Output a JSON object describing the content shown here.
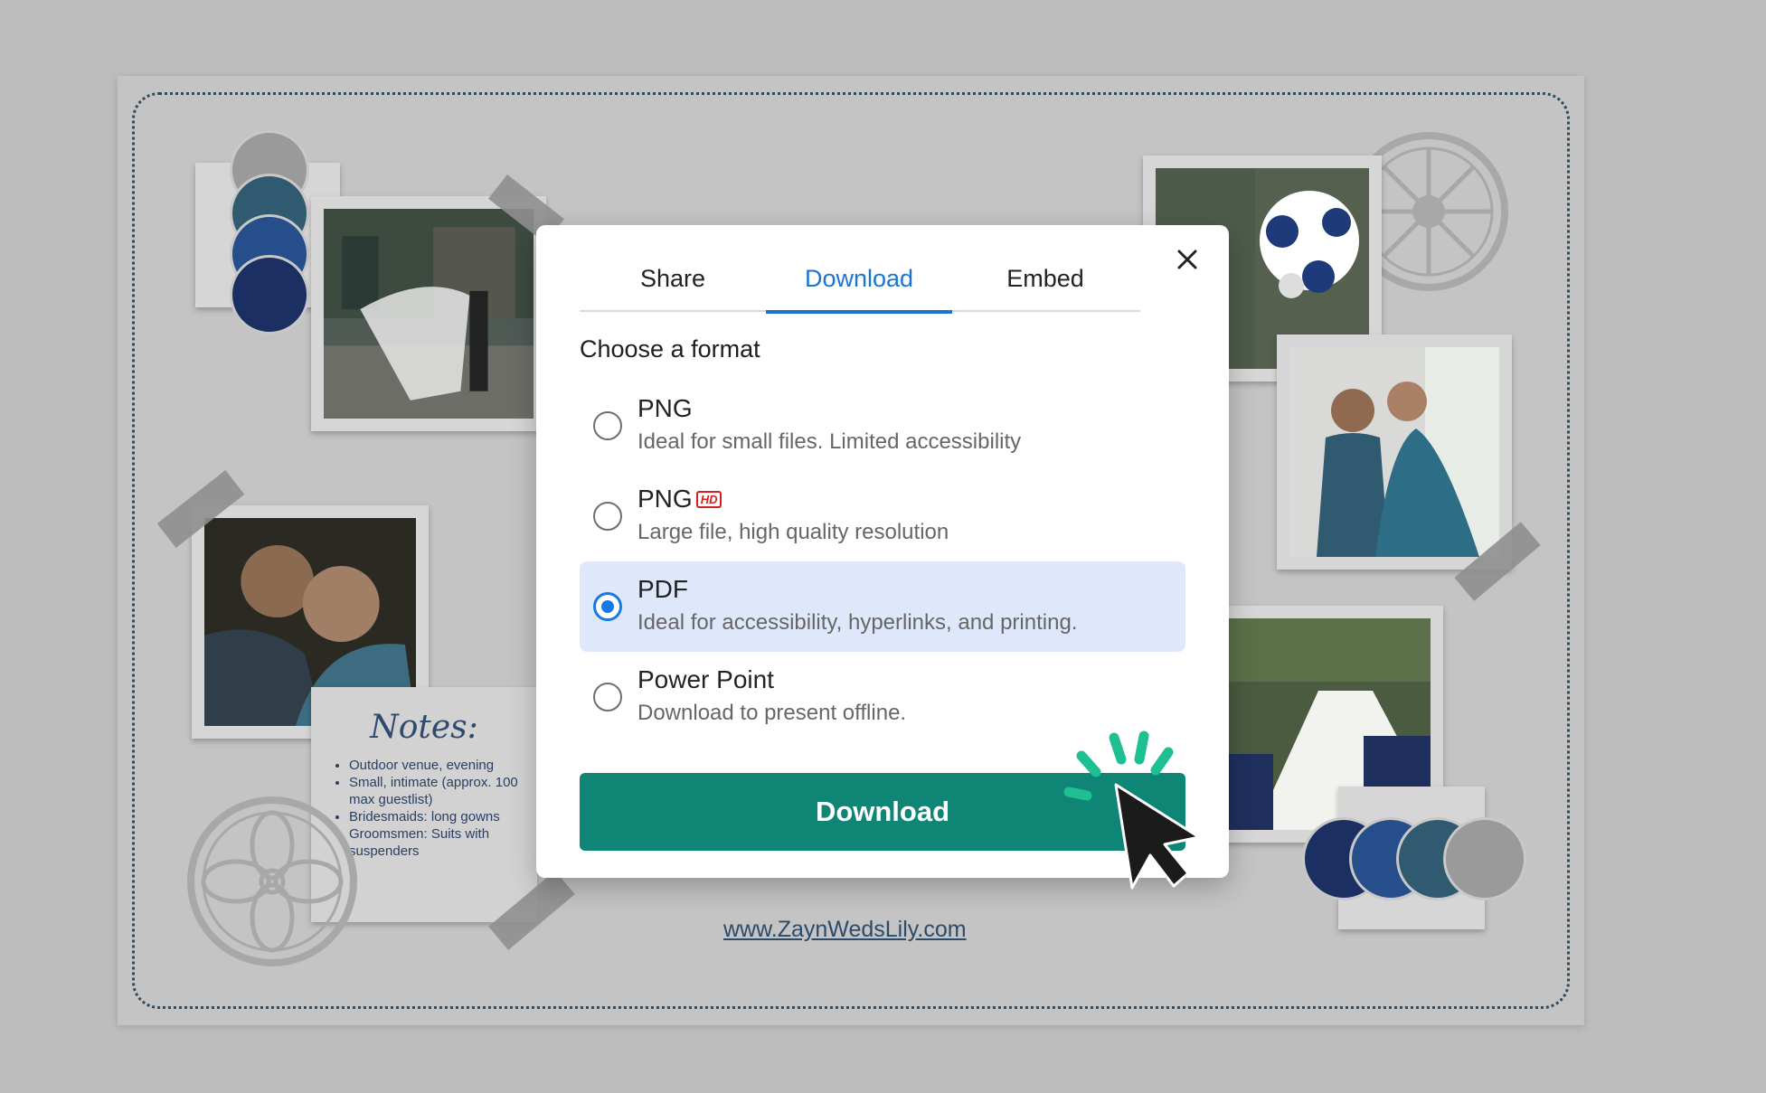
{
  "modal": {
    "tabs": [
      {
        "label": "Share"
      },
      {
        "label": "Download"
      },
      {
        "label": "Embed"
      }
    ],
    "active_tab": "Download",
    "section_title": "Choose a format",
    "options": [
      {
        "name": "PNG",
        "description": "Ideal for small files. Limited accessibility",
        "selected": false
      },
      {
        "name": "PNG",
        "badge": "HD",
        "description": "Large file, high quality resolution",
        "selected": false
      },
      {
        "name": "PDF",
        "description": "Ideal for accessibility, hyperlinks, and printing.",
        "selected": true
      },
      {
        "name": "Power Point",
        "description": "Download to present offline.",
        "selected": false
      }
    ],
    "download_label": "Download",
    "close_icon": "close-icon"
  },
  "board": {
    "notes": {
      "title": "Notes:",
      "items": [
        "Outdoor venue, evening",
        "Small, intimate (approx. 100 max guestlist)",
        "Bridesmaids: long gowns",
        "Groomsmen: Suits with suspenders"
      ]
    },
    "website": "www.ZaynWedsLily.com",
    "palette": [
      "#1c2f63",
      "#264e8a",
      "#2f5a70",
      "#9a9a9a"
    ]
  },
  "colors": {
    "accent": "#1b74d4",
    "button": "#0f8575",
    "selected_bg": "#dfe8fb",
    "spark": "#1fbf94"
  }
}
